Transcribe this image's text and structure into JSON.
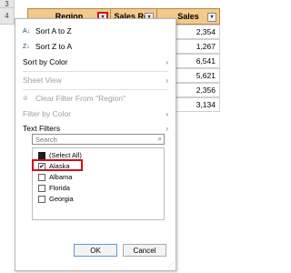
{
  "rows": [
    "3",
    "4"
  ],
  "headers": {
    "region": "Region",
    "sales_rep": "Sales Rep",
    "sales": "Sales",
    "dropdown_glyph": "▾"
  },
  "sales_cells": [
    {
      "currency": "$",
      "value": "2,354"
    },
    {
      "currency": "$",
      "value": "1,267"
    },
    {
      "currency": "$",
      "value": "6,541"
    },
    {
      "currency": "$",
      "value": "5,621"
    },
    {
      "currency": "$",
      "value": "2,356"
    },
    {
      "currency": "$",
      "value": "3,134"
    }
  ],
  "filter_menu": {
    "sort_az": "Sort A to Z",
    "sort_za": "Sort Z to A",
    "sort_by_color": "Sort by Color",
    "sheet_view": "Sheet View",
    "clear_filter": "Clear Filter From \"Region\"",
    "filter_by_color": "Filter by Color",
    "text_filters": "Text Filters",
    "search_placeholder": "Search",
    "items": [
      {
        "label": "(Select All)",
        "state": "partial"
      },
      {
        "label": "Alaska",
        "state": "checked"
      },
      {
        "label": "Albama",
        "state": "unchecked"
      },
      {
        "label": "Florida",
        "state": "unchecked"
      },
      {
        "label": "Georgia",
        "state": "unchecked"
      }
    ],
    "ok": "OK",
    "cancel": "Cancel"
  },
  "colors": {
    "header_fill": "#f3c98c",
    "highlight_red": "#d0101a"
  }
}
